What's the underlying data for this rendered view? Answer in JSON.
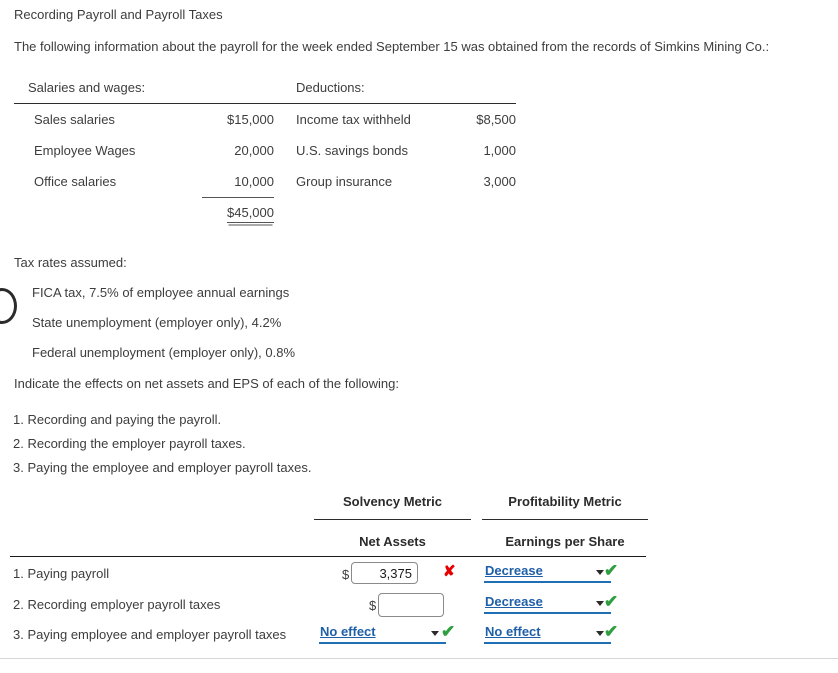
{
  "question": {
    "title": "Recording Payroll and Payroll Taxes",
    "intro": "The following information about the payroll for the week ended September 15 was obtained from the records of Simkins Mining Co.:"
  },
  "payroll_table": {
    "salaries_header": "Salaries and wages:",
    "deductions_header": "Deductions:",
    "rows": [
      {
        "salary_label": "Sales salaries",
        "salary_amount": "$15,000",
        "deduction_label": "Income tax withheld",
        "deduction_amount": "$8,500"
      },
      {
        "salary_label": "Employee Wages",
        "salary_amount": "20,000",
        "deduction_label": "U.S. savings bonds",
        "deduction_amount": "1,000"
      },
      {
        "salary_label": "Office salaries",
        "salary_amount": "10,000",
        "deduction_label": "Group insurance",
        "deduction_amount": "3,000"
      }
    ],
    "salaries_total": "$45,000"
  },
  "tax_rates": {
    "header": "Tax rates assumed:",
    "lines": [
      "FICA tax, 7.5% of employee annual earnings",
      "State unemployment (employer only), 4.2%",
      "Federal unemployment (employer only), 0.8%"
    ]
  },
  "instruction": "Indicate the effects on net assets and EPS of each of the following:",
  "numbered_items": [
    "1. Recording and paying the payroll.",
    "2. Recording the employer payroll taxes.",
    "3. Paying the employee and employer payroll taxes."
  ],
  "answer_table": {
    "group_headers": {
      "solvency": "Solvency Metric",
      "profitability": "Profitability Metric"
    },
    "sub_headers": {
      "net_assets": "Net Assets",
      "eps": "Earnings per Share"
    },
    "currency_symbol": "$",
    "rows": [
      {
        "label": "1. Paying payroll",
        "net_assets_type": "input",
        "net_assets_value": "3,375",
        "net_assets_mark": "cross",
        "eps_type": "dropdown",
        "eps_value": "Decrease",
        "eps_mark": "check"
      },
      {
        "label": "2. Recording employer payroll taxes",
        "net_assets_type": "input",
        "net_assets_value": "",
        "net_assets_mark": "none",
        "eps_type": "dropdown",
        "eps_value": "Decrease",
        "eps_mark": "check"
      },
      {
        "label": "3. Paying employee and employer payroll taxes",
        "net_assets_type": "dropdown",
        "net_assets_value": "No effect",
        "net_assets_mark": "check",
        "eps_type": "dropdown",
        "eps_value": "No effect",
        "eps_mark": "check"
      }
    ],
    "marks": {
      "cross_glyph": "✘",
      "check_glyph": "✔"
    },
    "colors": {
      "correct": "#2e9e3e",
      "incorrect": "#e60000",
      "dropdown_text": "#1f5fa8",
      "dropdown_underline": "#1f6fb5"
    }
  }
}
